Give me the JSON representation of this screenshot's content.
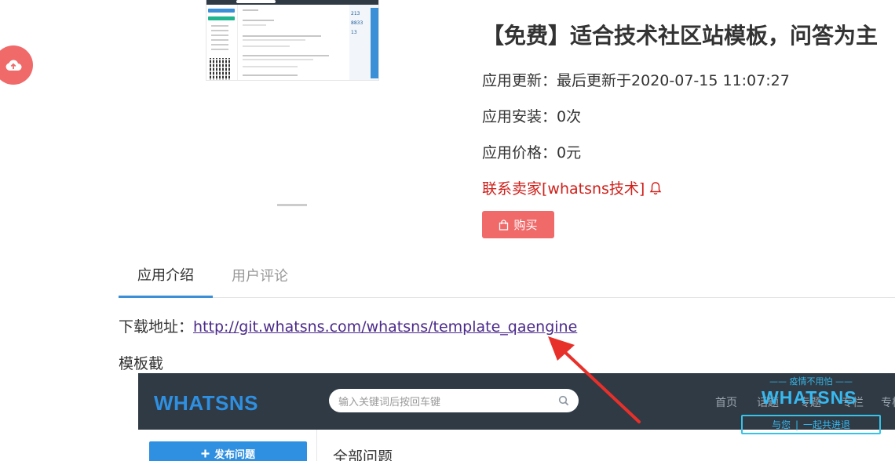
{
  "product": {
    "title": "【免费】适合技术社区站模板，问答为主",
    "update_label": "应用更新：",
    "update_value": "最后更新于2020-07-15 11:07:27",
    "install_label": "应用安装：",
    "install_value": "0次",
    "price_label": "应用价格：",
    "price_value": "0元",
    "contact_label": "联系卖家[whatsns技术]",
    "buy_label": "购买"
  },
  "thumbnail": {
    "stat_1": "213",
    "stat_2": "8833",
    "stat_3": "13"
  },
  "tabs": [
    {
      "label": "应用介绍",
      "active": true
    },
    {
      "label": "用户评论",
      "active": false
    }
  ],
  "content": {
    "download_label": "下载地址：",
    "download_url": "http://git.whatsns.com/whatsns/template_qaengine",
    "template_label": "模板截"
  },
  "embedded_screenshot": {
    "logo": "WHATSNS",
    "search_placeholder": "输入关键词后按回车键",
    "nav": [
      "首页",
      "话题",
      "专题",
      "专栏",
      "专栏"
    ],
    "post_button": "发布问题",
    "main_title": "全部问题"
  },
  "promo": {
    "top_text": "疫情不用怕",
    "brand": "WHATSNS",
    "left_text": "与您",
    "right_text": "一起共进退"
  },
  "colors": {
    "accent_red": "#f06a6a",
    "contact_red": "#d0201b",
    "tab_blue": "#3a8fd6",
    "link_purple": "#4b2a8a",
    "header_dark": "#2f3a45"
  },
  "icons": {
    "upload": "cloud-upload-icon",
    "bell": "bell-icon",
    "bag": "shopping-bag-icon",
    "search": "search-icon",
    "plus": "plus-icon"
  }
}
